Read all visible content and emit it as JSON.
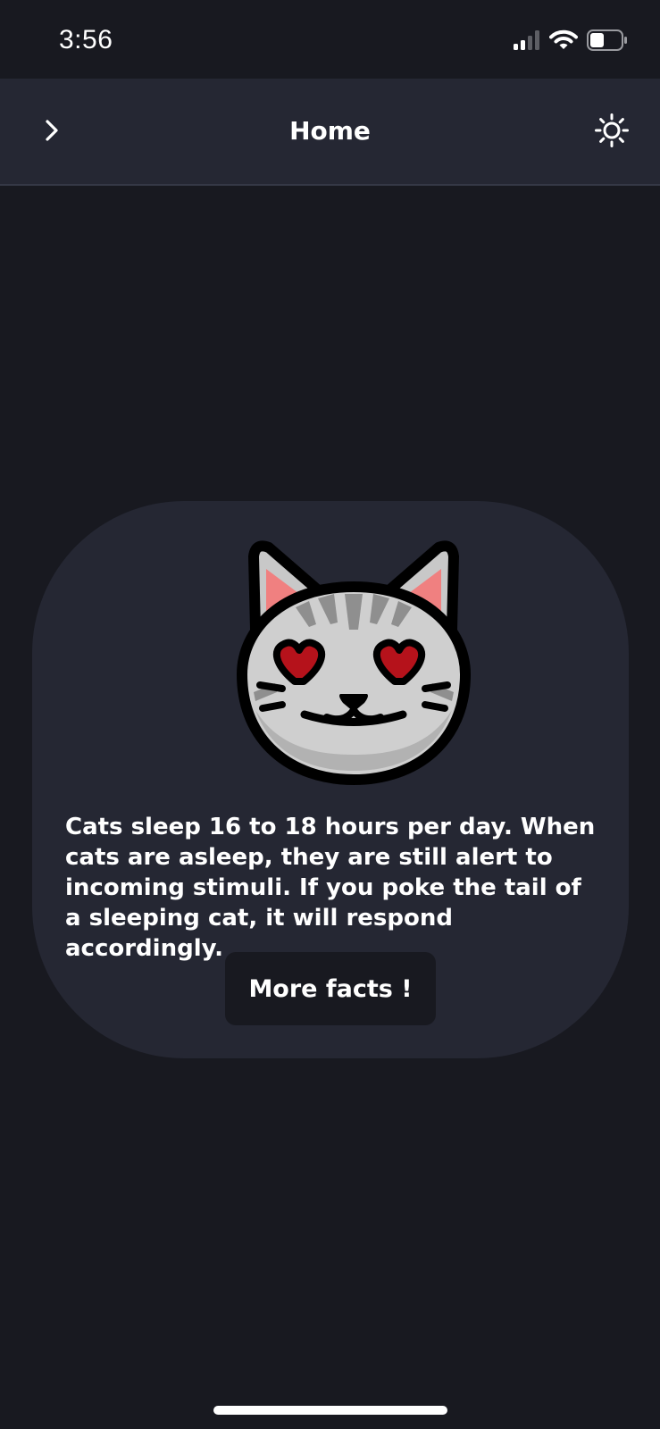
{
  "status_bar": {
    "time": "3:56",
    "icons": [
      "cellular-signal-icon",
      "wifi-icon",
      "battery-icon"
    ],
    "battery_level": 0.45
  },
  "navbar": {
    "title": "Home",
    "left_icon": "chevron-right-icon",
    "right_icon": "sun-icon"
  },
  "card": {
    "image": "cat-heart-eyes-icon",
    "fact": "Cats sleep 16 to 18 hours per day. When cats are asleep, they are still alert to incoming stimuli. If you poke the tail of a sleeping cat, it will respond accordingly.",
    "button_label": "More facts !"
  },
  "colors": {
    "background": "#181920",
    "surface": "#252733",
    "text": "#ffffff",
    "heart": "#b5121b",
    "ear_inner": "#f08080"
  }
}
